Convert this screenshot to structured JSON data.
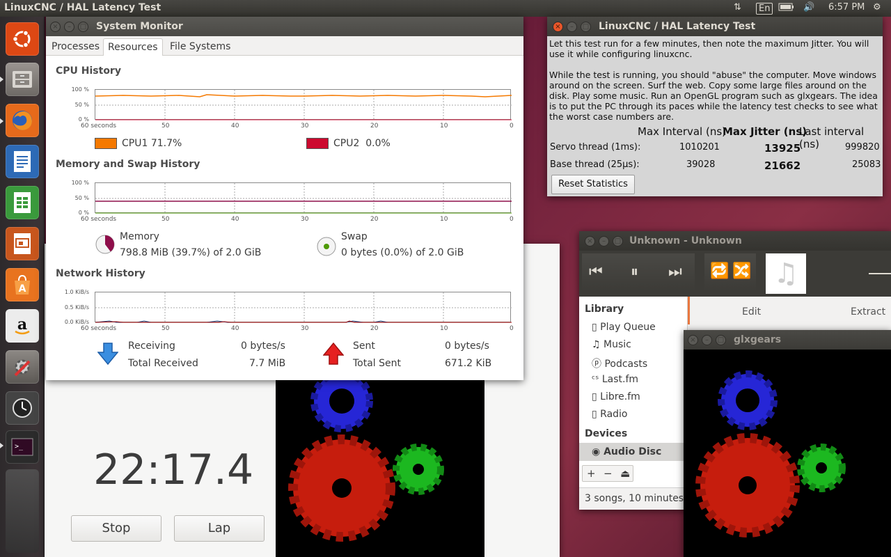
{
  "topbar": {
    "title": "LinuxCNC / HAL Latency Test",
    "keyboard": "En",
    "time": "6:57 PM"
  },
  "launcher": {
    "items": [
      {
        "name": "ubuntu-icon"
      },
      {
        "name": "files-icon"
      },
      {
        "name": "firefox-icon"
      },
      {
        "name": "writer-icon"
      },
      {
        "name": "calc-icon"
      },
      {
        "name": "impress-icon"
      },
      {
        "name": "software-center-icon"
      },
      {
        "name": "amazon-icon"
      },
      {
        "name": "settings-icon"
      },
      {
        "name": "clock-icon"
      },
      {
        "name": "terminal-icon"
      }
    ]
  },
  "sysmon": {
    "title": "System Monitor",
    "tabs": [
      "Processes",
      "Resources",
      "File Systems"
    ],
    "cpu": {
      "title": "CPU History",
      "yticks": [
        "100 %",
        "50 %",
        "0 %"
      ],
      "xticks": [
        "60 seconds",
        "50",
        "40",
        "30",
        "20",
        "10",
        "0"
      ],
      "cpu1_label": "CPU1 71.7%",
      "cpu2_label": "CPU2  0.0%",
      "cpu1_color": "#f57900",
      "cpu2_color": "#cc0a2f"
    },
    "memory": {
      "title": "Memory and Swap History",
      "yticks": [
        "100 %",
        "50 %",
        "0 %"
      ],
      "xticks": [
        "60 seconds",
        "50",
        "40",
        "30",
        "20",
        "10",
        "0"
      ],
      "memory_label": "Memory",
      "memory_value": "798.8 MiB (39.7%) of 2.0 GiB",
      "swap_label": "Swap",
      "swap_value": "0 bytes (0.0%) of 2.0 GiB",
      "memory_fraction": 0.397
    },
    "network": {
      "title": "Network History",
      "yticks": [
        "1.0 KiB/s",
        "0.5 KiB/s",
        "0.0 KiB/s"
      ],
      "xticks": [
        "60 seconds",
        "50",
        "40",
        "30",
        "20",
        "10",
        "0"
      ],
      "receiving_label": "Receiving",
      "receiving_value": "0 bytes/s",
      "total_received_label": "Total Received",
      "total_received_value": "7.7 MiB",
      "sent_label": "Sent",
      "sent_value": "0 bytes/s",
      "total_sent_label": "Total Sent",
      "total_sent_value": "671.2 KiB"
    }
  },
  "latency": {
    "title": "LinuxCNC / HAL Latency Test",
    "para1": "Let this test run for a few minutes, then note the maximum Jitter.  You will use it while configuring linuxcnc.",
    "para2": "While the test is running, you should \"abuse\" the computer. Move windows around on the screen. Surf the web. Copy some large files around on the disk. Play some music. Run an OpenGL program such as glxgears. The idea is to put the PC through its paces while the latency test checks to see what the worst case numbers are.",
    "col_max_interval": "Max Interval (ns)",
    "col_max_jitter": "Max Jitter (ns)",
    "col_last_interval": "Last interval (ns)",
    "rows": [
      {
        "label": "Servo thread (1ms):",
        "max_interval": "1010201",
        "max_jitter": "13925",
        "last_interval": "999820"
      },
      {
        "label": "Base thread (25µs):",
        "max_interval": "39028",
        "max_jitter": "21662",
        "last_interval": "25083"
      }
    ],
    "reset_label": "Reset Statistics"
  },
  "rhythmbox": {
    "title": "Unknown - Unknown",
    "menu_edit": "Edit",
    "menu_extract": "Extract",
    "library_header": "Library",
    "library_items": [
      "Play Queue",
      "Music",
      "Podcasts",
      "Last.fm",
      "Libre.fm",
      "Radio"
    ],
    "devices_header": "Devices",
    "device_item": "Audio Disc",
    "status": "3 songs, 10 minutes"
  },
  "glxgears": {
    "title": "glxgears"
  },
  "stopwatch": {
    "time": "22:17.4",
    "stop_label": "Stop",
    "lap_label": "Lap"
  }
}
